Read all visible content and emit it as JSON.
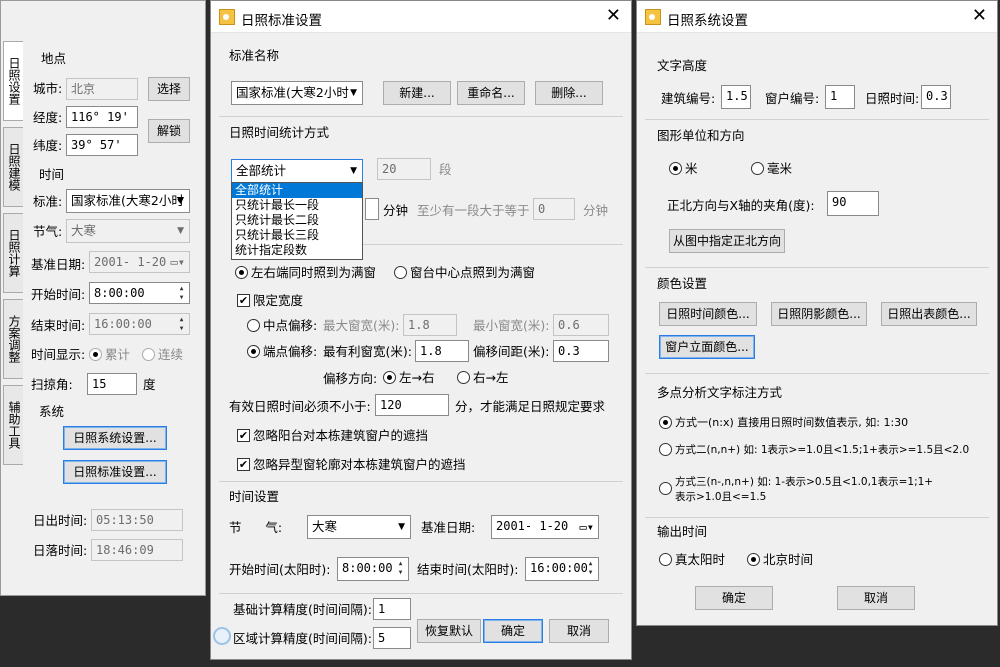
{
  "left_panel": {
    "tabs": [
      "日照设置",
      "日照建模",
      "日照计算",
      "方案调整",
      "辅助工具"
    ],
    "location_group": "地点",
    "city_label": "城市:",
    "city_value": "北京",
    "select_btn": "选择",
    "longitude_label": "经度:",
    "longitude_value": "116° 19'",
    "unlock_btn": "解锁",
    "latitude_label": "纬度:",
    "latitude_value": "39° 57'",
    "time_group": "时间",
    "standard_label": "标准:",
    "standard_value": "国家标准(大寒2小时",
    "solar_term_label": "节气:",
    "solar_term_value": "大寒",
    "base_date_label": "基准日期:",
    "base_date_value": "2001- 1-20",
    "start_time_label": "开始时间:",
    "start_time_value": "8:00:00",
    "end_time_label": "结束时间:",
    "end_time_value": "16:00:00",
    "time_display_label": "时间显示:",
    "cumulative_label": "累计",
    "continuous_label": "连续",
    "scan_label": "扫掠角:",
    "scan_value": "15",
    "scan_unit": "度",
    "system_group": "系统",
    "sys_settings_btn": "日照系统设置...",
    "std_settings_btn": "日照标准设置...",
    "sunrise_label": "日出时间:",
    "sunrise_value": "05:13:50",
    "sunset_label": "日落时间:",
    "sunset_value": "18:46:09"
  },
  "standard_dialog": {
    "title": "日照标准设置",
    "name_group": "标准名称",
    "name_value": "国家标准(大寒2小时",
    "new_btn": "新建...",
    "rename_btn": "重命名...",
    "delete_btn": "删除...",
    "method_group": "日照时间统计方式",
    "method_value": "全部统计",
    "segments_value": "20",
    "segments_unit": "段",
    "dropdown_options": [
      "全部统计",
      "只统计最长一段",
      "只统计最长二段",
      "只统计最长三段",
      "统计指定段数"
    ],
    "minutes_unit": "分钟",
    "at_least_label": "至少有一段大于等于",
    "at_least_value": "0",
    "at_least_unit": "分钟",
    "radio_both_ends": "左右端同时照到为满窗",
    "radio_center": "窗台中心点照到为满窗",
    "limit_width": "限定宽度",
    "center_offset": "中点偏移:",
    "max_width_label": "最大窗宽(米):",
    "max_width_value": "1.8",
    "min_width_label": "最小窗宽(米):",
    "min_width_value": "0.6",
    "end_offset": "端点偏移:",
    "best_width_label": "最有利窗宽(米):",
    "best_width_value": "1.8",
    "offset_spacing_label": "偏移间距(米):",
    "offset_spacing_value": "0.3",
    "offset_dir_label": "偏移方向:",
    "left_to_right": "左→右",
    "right_to_left": "右→左",
    "valid_time_label": "有效日照时间必须不小于:",
    "valid_time_value": "120",
    "valid_time_suffix": "分，才能满足日照规定要求",
    "ignore_balcony": "忽略阳台对本栋建筑窗户的遮挡",
    "ignore_special": "忽略异型窗轮廓对本栋建筑窗户的遮挡",
    "time_group": "时间设置",
    "solar_term_label": "节      气:",
    "solar_term_value": "大寒",
    "base_date_label": "基准日期:",
    "base_date_value": "2001- 1-20",
    "start_label": "开始时间(太阳时):",
    "start_value": "8:00:00",
    "end_label": "结束时间(太阳时):",
    "end_value": "16:00:00",
    "base_precision_label": "基础计算精度(时间间隔):",
    "base_precision_value": "1",
    "area_precision_label": "区域计算精度(时间间隔):",
    "area_precision_value": "5",
    "restore_btn": "恢复默认",
    "ok_btn": "确定",
    "cancel_btn": "取消"
  },
  "system_dialog": {
    "title": "日照系统设置",
    "text_height_group": "文字高度",
    "building_no_label": "建筑编号:",
    "building_no_value": "1.5",
    "window_no_label": "窗户编号:",
    "window_no_value": "1",
    "sun_time_label": "日照时间:",
    "sun_time_value": "0.3",
    "unit_group": "图形单位和方向",
    "meter": "米",
    "millimeter": "毫米",
    "north_angle_label": "正北方向与X轴的夹角(度):",
    "north_angle_value": "90",
    "pick_north_btn": "从图中指定正北方向",
    "color_group": "颜色设置",
    "sun_time_color_btn": "日照时间颜色...",
    "shadow_color_btn": "日照阴影颜色...",
    "report_color_btn": "日照出表颜色...",
    "facade_color_btn": "窗户立面颜色...",
    "multipoint_group": "多点分析文字标注方式",
    "mode1": "方式一(n:x)  直接用日照时间数值表示, 如: 1:30",
    "mode2": "方式二(n,n+)  如: 1表示>=1.0且<1.5;1+表示>=1.5且<2.0",
    "mode3_line1": "方式三(n-,n,n+)  如: 1-表示>0.5且<1.0,1表示=1;1+",
    "mode3_line2": "表示>1.0且<=1.5",
    "output_time_group": "输出时间",
    "true_solar": "真太阳时",
    "beijing_time": "北京时间",
    "ok_btn": "确定",
    "cancel_btn": "取消"
  }
}
